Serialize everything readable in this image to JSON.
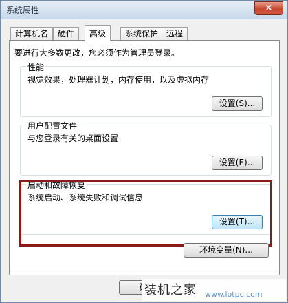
{
  "window": {
    "title": "系统属性",
    "close_label": "×"
  },
  "tabs": [
    {
      "label": "计算机名",
      "active": false
    },
    {
      "label": "硬件",
      "active": false
    },
    {
      "label": "高级",
      "active": true
    },
    {
      "label": "系统保护",
      "active": false
    },
    {
      "label": "远程",
      "active": false
    }
  ],
  "panel": {
    "admin_note": "要进行大多数更改，您必须作为管理员登录。",
    "performance": {
      "title": "性能",
      "desc": "视觉效果，处理器计划，内存使用，以及虚拟内存",
      "button": "设置(S)..."
    },
    "profile": {
      "title": "用户配置文件",
      "desc": "与您登录有关的桌面设置",
      "button": "设置(E)..."
    },
    "startup": {
      "title": "启动和故障恢复",
      "desc": "系统启动、系统失败和调试信息",
      "button": "设置(T)..."
    },
    "env_button": "环境变量(N)..."
  },
  "footer": {
    "ok_label": "确"
  },
  "watermark": {
    "main": "装机之家",
    "sub": "www.lotpc.com"
  }
}
